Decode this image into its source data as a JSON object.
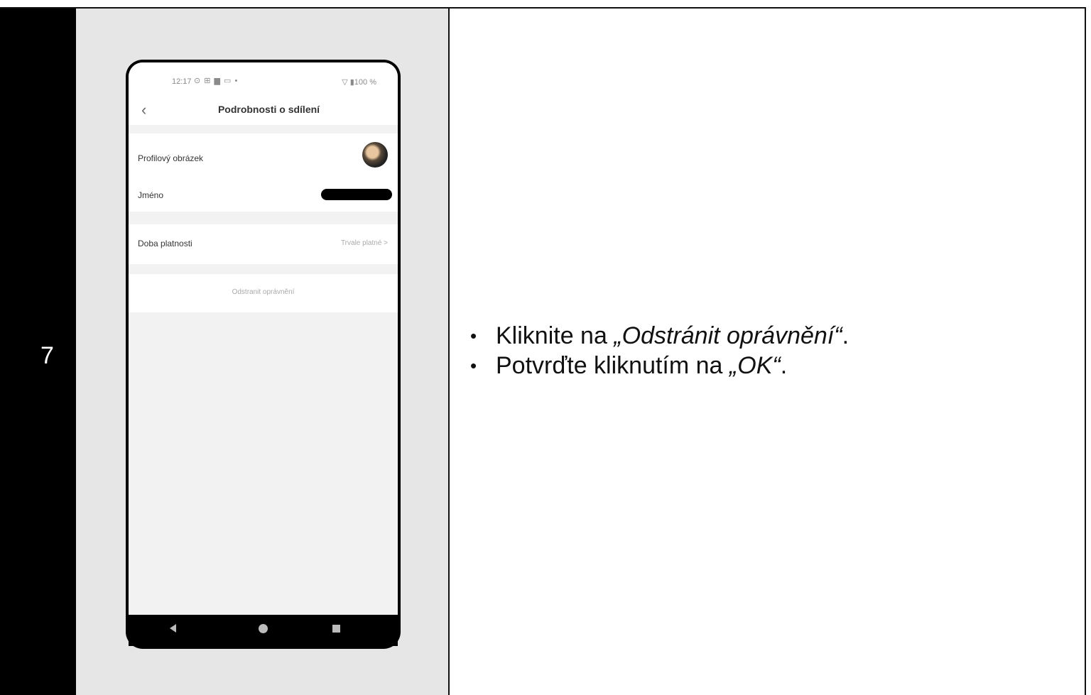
{
  "step_number": "7",
  "phone": {
    "status_time": "12:17",
    "status_icons": "⊙ ⊞ ▆ ▭ •",
    "status_right": "▽ ▮100 %",
    "title": "Podrobnosti o sdílení",
    "profile_label": "Profilový obrázek",
    "name_label": "Jméno",
    "validity_label": "Doba platnosti",
    "validity_value": "Trvale platné  >",
    "remove_button": "Odstranit oprávnění"
  },
  "instructions": [
    {
      "prefix": "Kliknite na ",
      "quoted": "„Odstránit oprávnění“",
      "suffix": "."
    },
    {
      "prefix": "Potvrďte kliknutím na ",
      "quoted": "„OK“",
      "suffix": "."
    }
  ]
}
